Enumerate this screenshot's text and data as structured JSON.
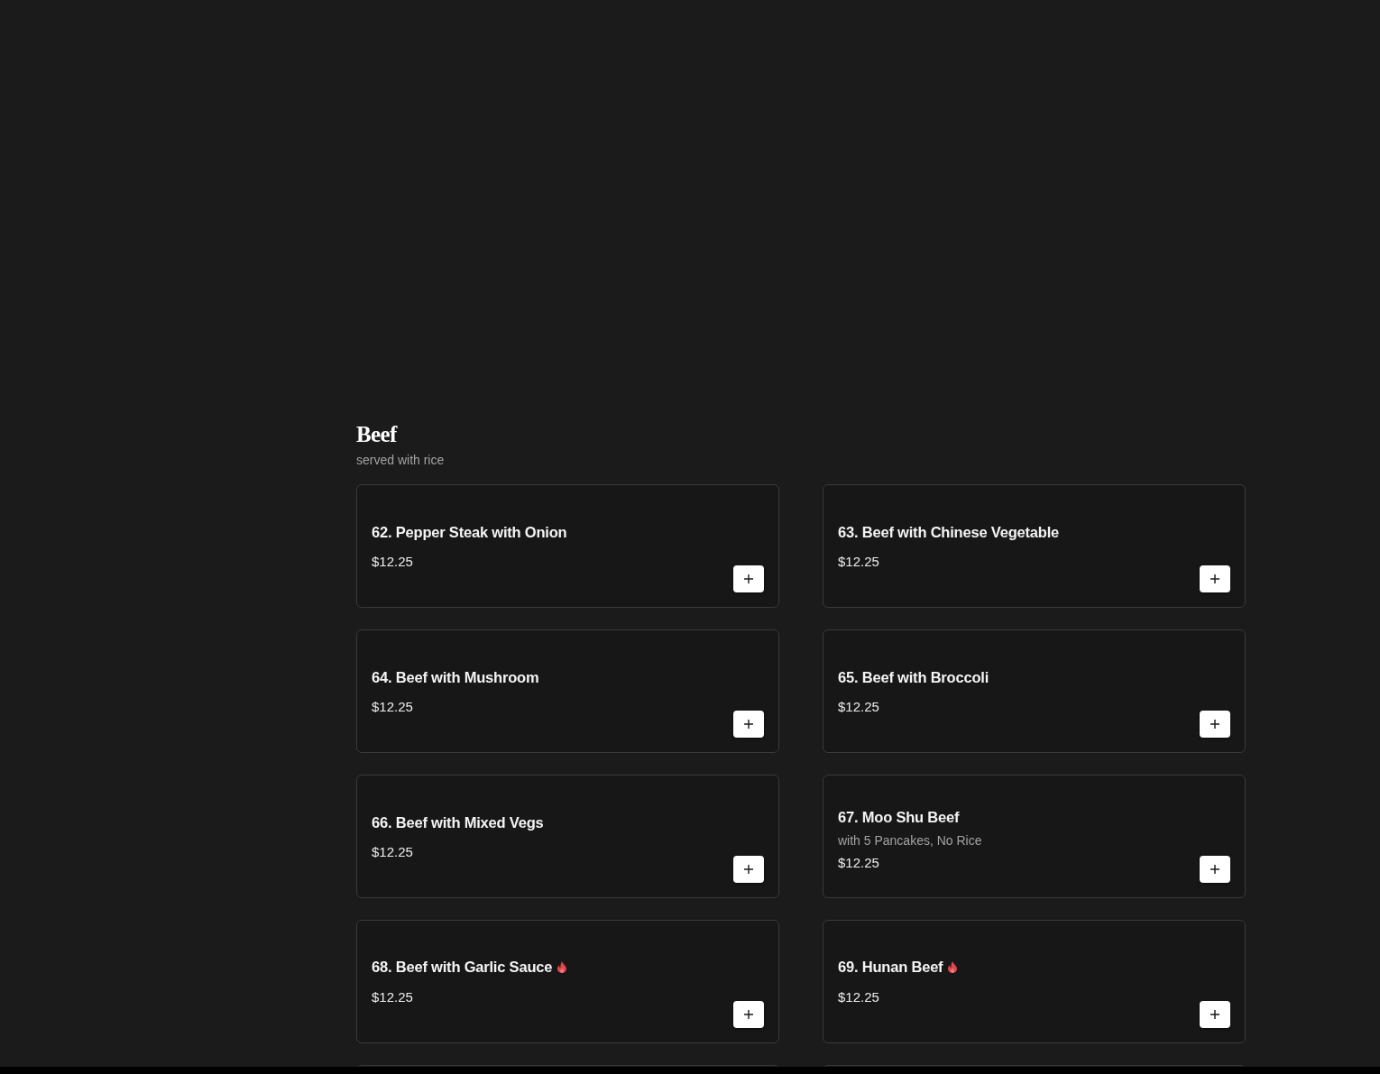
{
  "section": {
    "title": "Beef",
    "subtitle": "served with rice"
  },
  "items": [
    {
      "kind": "dish",
      "name": "62. Pepper Steak with Onion",
      "price": "$12.25",
      "spicy": false
    },
    {
      "kind": "dish",
      "name": "63. Beef with Chinese Vegetable",
      "price": "$12.25",
      "spicy": false
    },
    {
      "kind": "dish",
      "name": "64. Beef with Mushroom",
      "price": "$12.25",
      "spicy": false
    },
    {
      "kind": "dish",
      "name": "65. Beef with Broccoli",
      "price": "$12.25",
      "spicy": false
    },
    {
      "kind": "dish",
      "name": "66. Beef with Mixed Vegs",
      "price": "$12.25",
      "spicy": false
    },
    {
      "kind": "dish",
      "name": "67. Moo Shu Beef",
      "description": "with 5 Pancakes, No Rice",
      "price": "$12.25",
      "spicy": false
    },
    {
      "kind": "dish",
      "name": "68. Beef with Garlic Sauce",
      "price": "$12.25",
      "spicy": true
    },
    {
      "kind": "dish",
      "name": "69. Hunan Beef",
      "price": "$12.25",
      "spicy": true
    },
    {
      "kind": "cut_off"
    },
    {
      "kind": "cut_off"
    }
  ]
}
